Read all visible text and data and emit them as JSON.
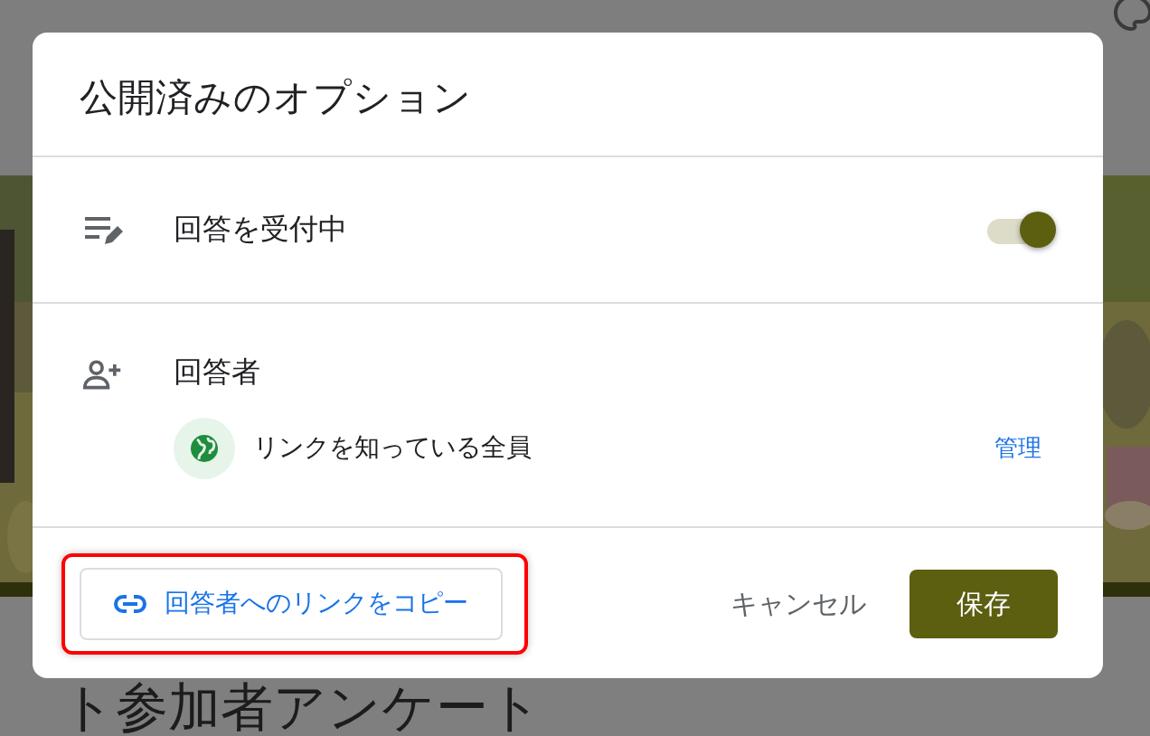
{
  "page": {
    "title": "ト参加者アンケート"
  },
  "dialog": {
    "title": "公開済みのオプション",
    "accepting": {
      "label": "回答を受付中",
      "on": true
    },
    "responders": {
      "label": "回答者",
      "audience": "リンクを知っている全員",
      "manage": "管理"
    },
    "copy_link": {
      "label": "回答者へのリンクをコピー",
      "highlighted": true
    },
    "buttons": [
      {
        "kind": "text",
        "label": "キャンセル"
      },
      {
        "kind": "filled",
        "label": "保存"
      }
    ]
  }
}
